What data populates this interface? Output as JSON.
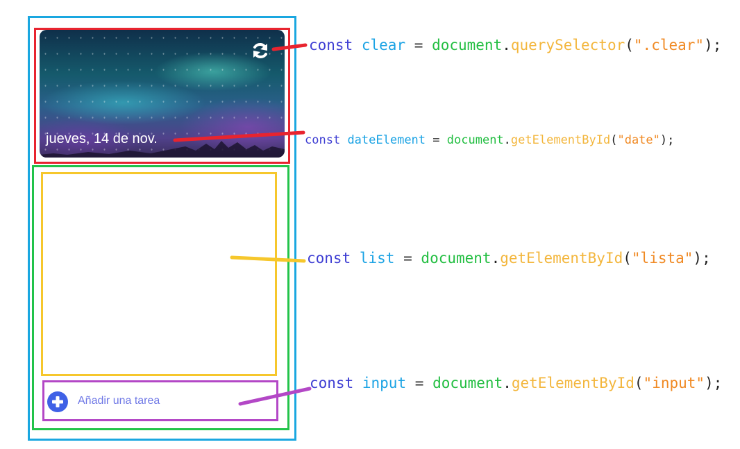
{
  "header": {
    "date": "jueves, 14 de nov.",
    "refresh_icon": "refresh-icon"
  },
  "input_area": {
    "placeholder": "Añadir una tarea",
    "icon": "plus-circle-icon"
  },
  "colors": {
    "container": "#1aa7e0",
    "header_box": "#e8242f",
    "content_box": "#22c34a",
    "list_box": "#f6c72c",
    "input_box": "#b347c6"
  },
  "annotations": [
    {
      "keyword": "const",
      "name": "clear",
      "eq": "=",
      "object": "document",
      "dot": ".",
      "method": "querySelector",
      "open": "(",
      "arg": "\".clear\"",
      "close": ");"
    },
    {
      "keyword": "const",
      "name": "dateElement",
      "eq": "=",
      "object": "document",
      "dot": ".",
      "method": "getElementById",
      "open": "(",
      "arg": "\"date\"",
      "close": ");"
    },
    {
      "keyword": "const",
      "name": "list",
      "eq": "=",
      "object": "document",
      "dot": ".",
      "method": "getElementById",
      "open": "(",
      "arg": "\"lista\"",
      "close": ");"
    },
    {
      "keyword": "const",
      "name": "input",
      "eq": "=",
      "object": "document",
      "dot": ".",
      "method": "getElementById",
      "open": "(",
      "arg": "\"input\"",
      "close": ");"
    }
  ]
}
